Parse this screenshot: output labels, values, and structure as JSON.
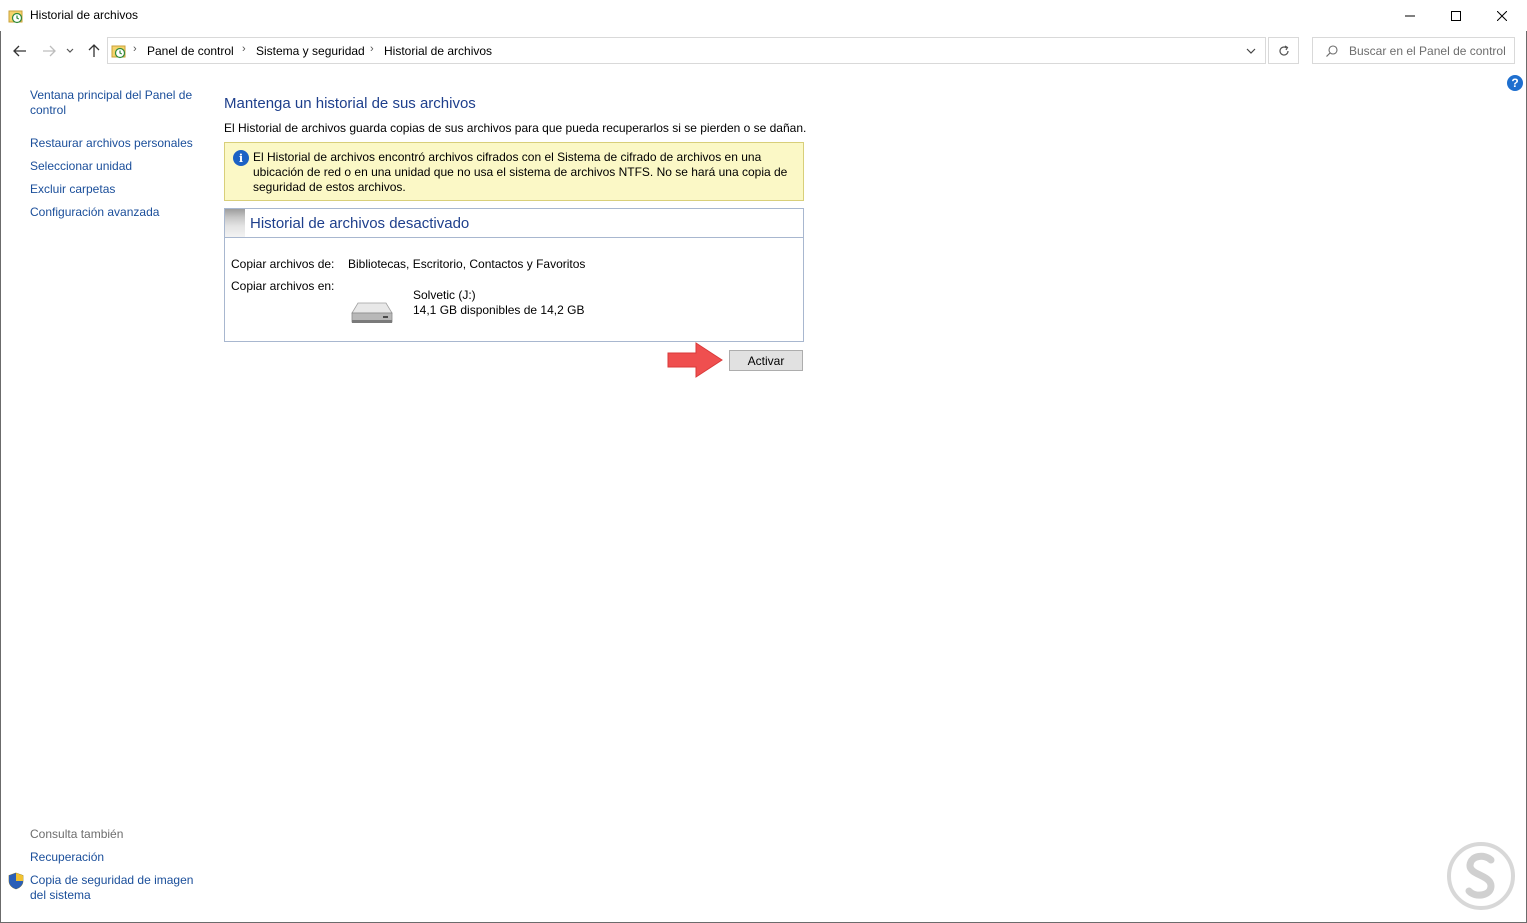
{
  "window": {
    "title": "Historial de archivos"
  },
  "navigation": {
    "breadcrumbs": [
      "Panel de control",
      "Sistema y seguridad",
      "Historial de archivos"
    ],
    "search_placeholder": "Buscar en el Panel de control"
  },
  "sidebar": {
    "links": [
      {
        "label_line1": "Ventana principal del Panel de",
        "label_line2": "control"
      },
      {
        "label_line1": "Restaurar archivos personales"
      },
      {
        "label_line1": "Seleccionar unidad"
      },
      {
        "label_line1": "Excluir carpetas"
      },
      {
        "label_line1": "Configuración avanzada"
      }
    ],
    "see_also_heading": "Consulta también",
    "see_also": [
      {
        "label_line1": "Recuperación"
      },
      {
        "label_line1": "Copia de seguridad de imagen",
        "label_line2": "del sistema"
      }
    ]
  },
  "main": {
    "title": "Mantenga un historial de sus archivos",
    "description": "El Historial de archivos guarda copias de sus archivos para que pueda recuperarlos si se pierden o se dañan.",
    "info_banner": {
      "line1": "El Historial de archivos encontró archivos cifrados con el Sistema de cifrado de archivos en una",
      "line2": "ubicación de red o en una unidad que no usa el sistema de archivos NTFS. No se hará una copia de",
      "line3": "seguridad de estos archivos."
    },
    "status_panel": {
      "title": "Historial de archivos desactivado",
      "copy_from_label": "Copiar archivos de:",
      "copy_from_value": "Bibliotecas, Escritorio, Contactos y Favoritos",
      "copy_to_label": "Copiar archivos en:",
      "drive_name": "Solvetic (J:)",
      "drive_space": "14,1 GB disponibles de 14,2 GB"
    },
    "activate_button": "Activar"
  },
  "colors": {
    "link": "#1a4e9a",
    "heading": "#1e3f8c",
    "banner_bg": "#fbf8c6",
    "arrow": "#ef4f4f"
  }
}
